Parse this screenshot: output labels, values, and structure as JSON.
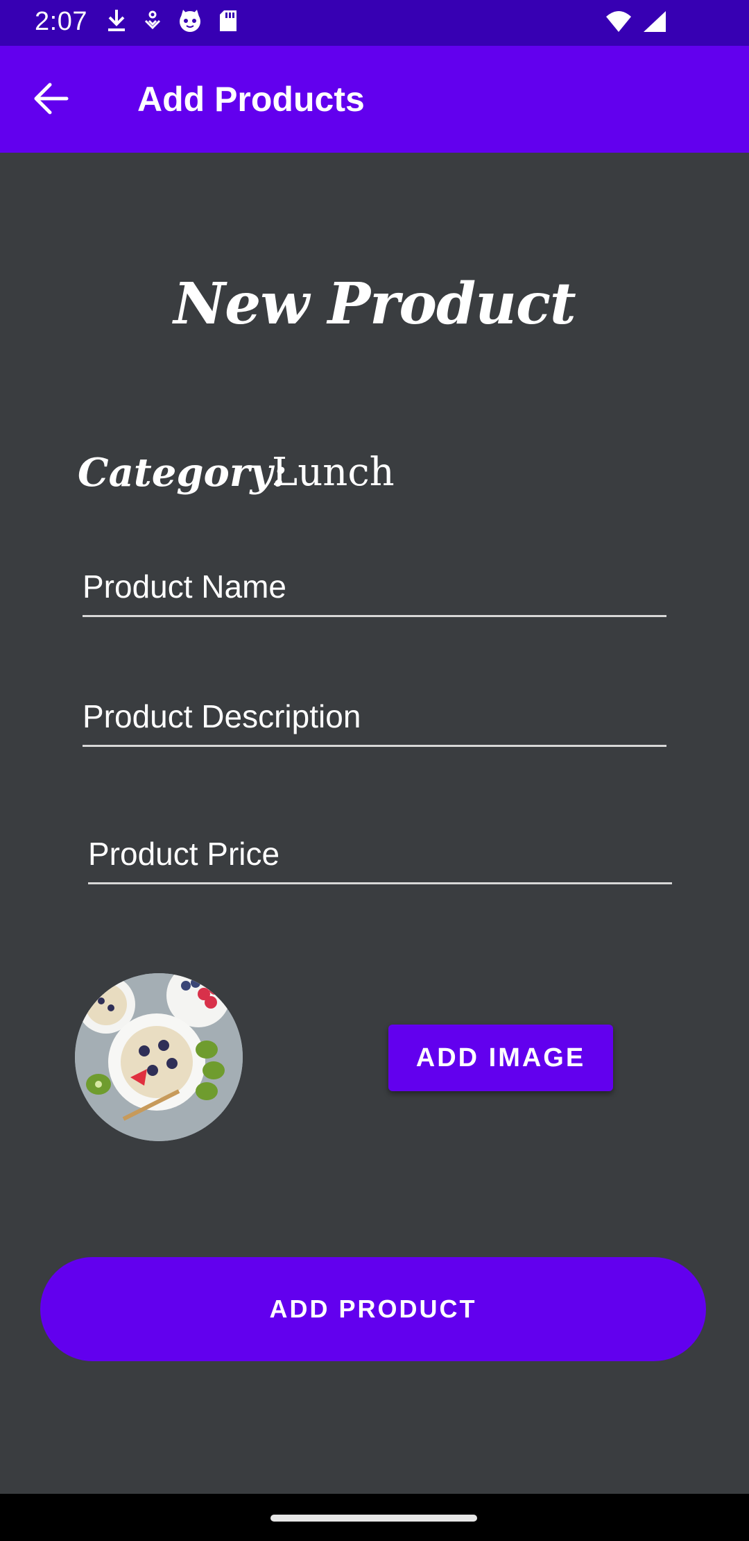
{
  "status_bar": {
    "time": "2:07",
    "icons_left": [
      "download-icon",
      "navigation-icon",
      "cat-face-icon",
      "sd-card-icon"
    ],
    "icons_right": [
      "wifi-icon",
      "signal-icon"
    ]
  },
  "app_bar": {
    "title": "Add Products",
    "back_icon": "arrow-back-icon",
    "color": "#6200ee"
  },
  "form": {
    "heading": "New Product",
    "category_label": "Category:",
    "category_value": "Lunch",
    "product_name_placeholder": "Product Name",
    "product_description_placeholder": "Product Description",
    "product_price_placeholder": "Product Price"
  },
  "image_section": {
    "add_image_label": "ADD IMAGE"
  },
  "actions": {
    "add_product_label": "ADD PRODUCT"
  },
  "colors": {
    "status_bar": "#3700b3",
    "accent": "#6200ee",
    "background": "#3a3d40"
  }
}
